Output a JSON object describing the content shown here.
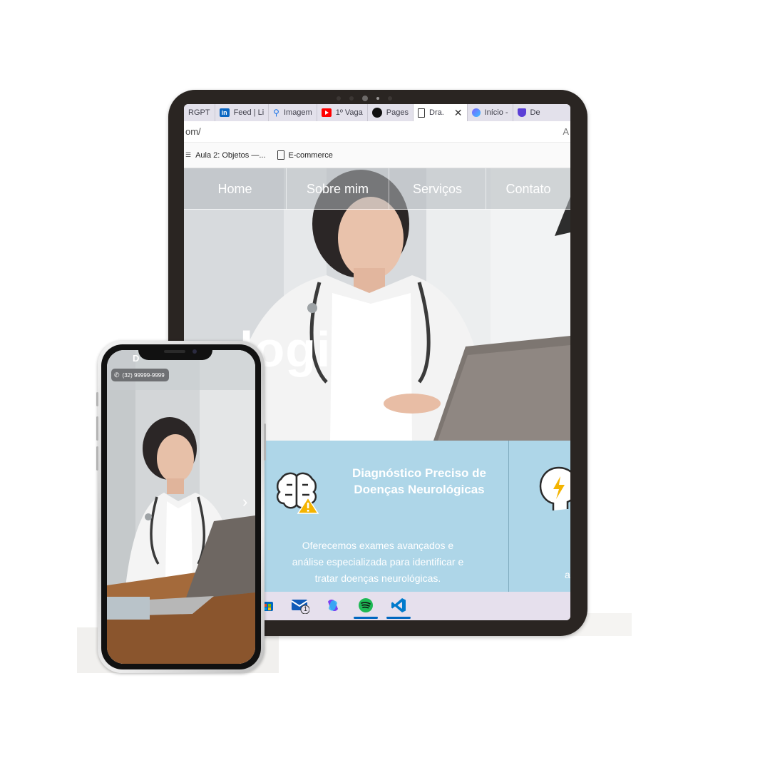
{
  "browser": {
    "tabs": [
      {
        "label": "RGPT",
        "color": "#10a37f"
      },
      {
        "label": "Feed | Li",
        "color": "#0a66c2"
      },
      {
        "label": "Imagem",
        "color": "#5f6368"
      },
      {
        "label": "1º Vaga",
        "color": "#ff0000"
      },
      {
        "label": "Pages",
        "color": "#111111"
      },
      {
        "label": "Dra.",
        "color": "#ffffff"
      },
      {
        "label": "Início -",
        "color": "#7b61ff"
      },
      {
        "label": "De",
        "color": "#5b3fd6"
      }
    ],
    "active_tab_close": "✕",
    "address": "om/",
    "reader_icon": "A",
    "bookmarks": [
      {
        "label": "Aula 2: Objetos —..."
      },
      {
        "label": "E-commerce"
      }
    ]
  },
  "site": {
    "nav": [
      "Home",
      "Sobre mim",
      "Serviços",
      "Contato"
    ],
    "hero_title": "logista",
    "services": {
      "card1_title": "Diagnóstico Preciso de Doenças Neurológicas",
      "card1_desc": "Oferecemos exames avançados e análise especializada para identificar e tratar doenças neurológicas.",
      "card2_desc_fragment": "a"
    }
  },
  "taskbar": {
    "icons": [
      "store-icon",
      "mail-icon",
      "copilot-icon",
      "spotify-icon",
      "vscode-icon"
    ],
    "mail_badge": "1"
  },
  "phone": {
    "logo": "D",
    "phone_number": "(32) 99999-9999",
    "carousel_arrow": "›"
  },
  "colors": {
    "service_bg": "#aed6e8",
    "taskbar_bg": "#e6e0ed",
    "tablet_frame": "#2a2522",
    "accent_blue": "#0067c0"
  }
}
